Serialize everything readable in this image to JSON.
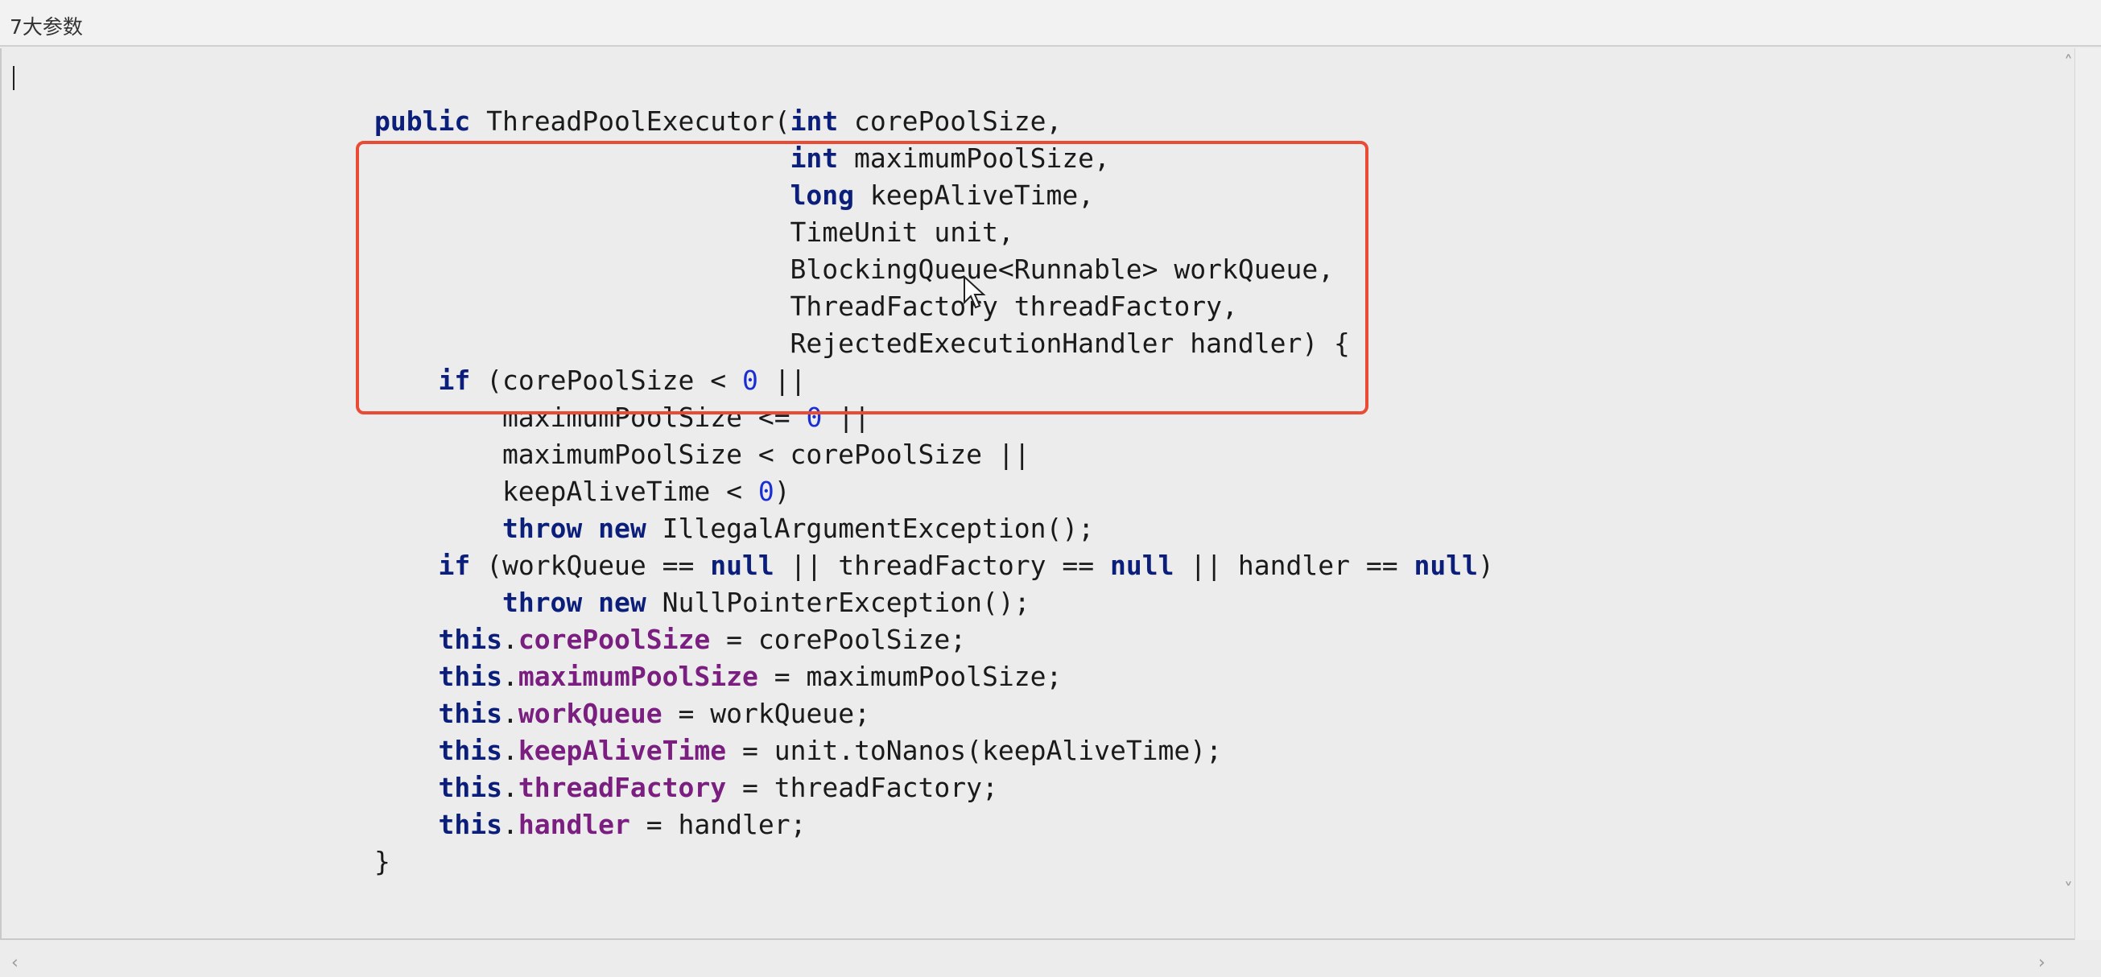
{
  "window": {
    "title": "7大参数"
  },
  "code": {
    "lines": [
      "public ThreadPoolExecutor(int corePoolSize,",
      "                          int maximumPoolSize,",
      "                          long keepAliveTime,",
      "                          TimeUnit unit,",
      "                          BlockingQueue<Runnable> workQueue,",
      "                          ThreadFactory threadFactory,",
      "                          RejectedExecutionHandler handler) {",
      "    if (corePoolSize < 0 ||",
      "        maximumPoolSize <= 0 ||",
      "        maximumPoolSize < corePoolSize ||",
      "        keepAliveTime < 0)",
      "        throw new IllegalArgumentException();",
      "    if (workQueue == null || threadFactory == null || handler == null)",
      "        throw new NullPointerException();",
      "    this.corePoolSize = corePoolSize;",
      "    this.maximumPoolSize = maximumPoolSize;",
      "    this.workQueue = workQueue;",
      "    this.keepAliveTime = unit.toNanos(keepAliveTime);",
      "    this.threadFactory = threadFactory;",
      "    this.handler = handler;",
      "}"
    ]
  },
  "colors": {
    "keyword": "#0b1f7a",
    "field": "#7a1f80",
    "number": "#1b2fd0",
    "highlight_border": "#e94b35"
  },
  "icons": {
    "scroll_up": "chevron-up-icon",
    "scroll_down": "chevron-down-icon",
    "scroll_left": "chevron-left-icon",
    "scroll_right": "chevron-right-icon",
    "pointer": "mouse-pointer-icon"
  }
}
